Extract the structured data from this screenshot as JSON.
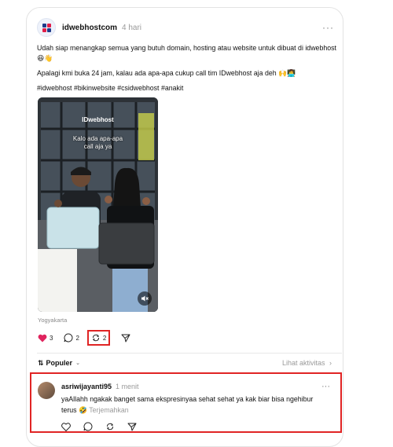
{
  "post": {
    "username": "idwebhostcom",
    "time": "4 hari",
    "more": "···",
    "caption_line1": "Udah siap menangkap semua yang butuh domain, hosting atau website untuk dibuat di idwebhost 😆👋",
    "caption_line2": "Apalagi kmi buka 24 jam, kalau ada apa-apa cukup call tim IDwebhost aja deh 🙌👩‍💻",
    "hashtags": "#idwebhost #bikinwebsite #csidwebhost #anakit",
    "media": {
      "brand_overlay": "IDwebhost",
      "overlay_text_line1": "Kalo ada apa-apa",
      "overlay_text_line2": "call aja ya"
    },
    "location": "Yogyakarta",
    "likes": "3",
    "comments": "2",
    "reposts": "2"
  },
  "sort": {
    "label": "Populer",
    "activity_link": "Lihat aktivitas"
  },
  "reply": {
    "username": "asriwijayanti95",
    "time": "1 menit",
    "more": "···",
    "text": "yaAllahh ngakak banget sama ekspresinyaa sehat sehat ya kak biar bisa ngehibur terus 🤣",
    "translate": "Terjemahkan"
  },
  "colors": {
    "highlight": "#e02424",
    "like": "#e0245e"
  }
}
